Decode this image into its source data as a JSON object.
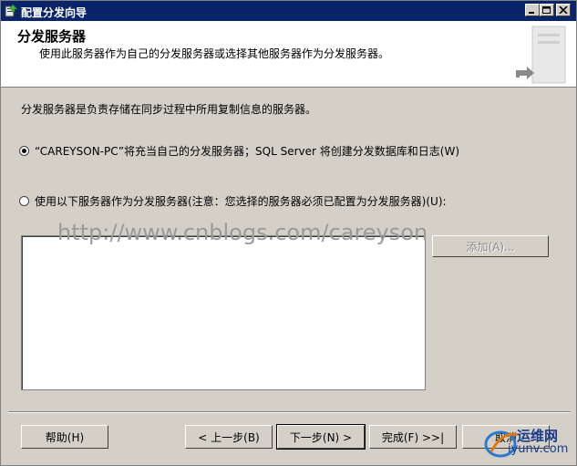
{
  "window": {
    "title": "配置分发向导"
  },
  "header": {
    "title": "分发服务器",
    "subtitle": "使用此服务器作为自己的分发服务器或选择其他服务器作为分发服务器。"
  },
  "description": "分发服务器是负责存储在同步过程中所用复制信息的服务器。",
  "options": [
    {
      "label": "“CAREYSON-PC”将充当自己的分发服务器；SQL Server 将创建分发数据库和日志(W)",
      "checked": true
    },
    {
      "label": "使用以下服务器作为分发服务器(注意：您选择的服务器必须已配置为分发服务器)(U):",
      "checked": false
    }
  ],
  "add_button": "添加(A)...",
  "watermark": "http://www.cnblogs.com/careyson",
  "buttons": {
    "help": "帮助(H)",
    "back": "< 上一步(B)",
    "next": "下一步(N) >",
    "finish": "完成(F) >>|",
    "cancel": "取消"
  },
  "branding": {
    "name": "运维网",
    "url": "iyunv.com"
  },
  "colors": {
    "titlebar": "#0a246a",
    "face": "#d4d0c8",
    "header_bg": "#ffffff"
  }
}
